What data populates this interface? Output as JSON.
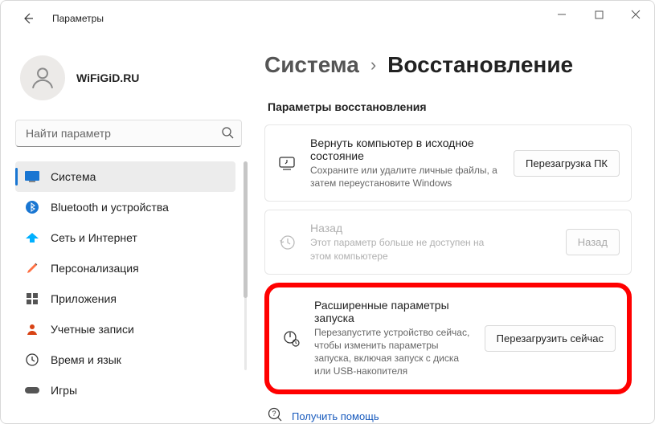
{
  "window": {
    "title": "Параметры"
  },
  "user": {
    "name": "WiFiGiD.RU"
  },
  "search": {
    "placeholder": "Найти параметр"
  },
  "nav": {
    "items": [
      {
        "label": "Система",
        "icon": "system",
        "active": true
      },
      {
        "label": "Bluetooth и устройства",
        "icon": "bluetooth"
      },
      {
        "label": "Сеть и Интернет",
        "icon": "network"
      },
      {
        "label": "Персонализация",
        "icon": "personalize"
      },
      {
        "label": "Приложения",
        "icon": "apps"
      },
      {
        "label": "Учетные записи",
        "icon": "accounts"
      },
      {
        "label": "Время и язык",
        "icon": "time"
      },
      {
        "label": "Игры",
        "icon": "games"
      }
    ]
  },
  "breadcrumb": {
    "parent": "Система",
    "current": "Восстановление"
  },
  "section_title": "Параметры восстановления",
  "cards": [
    {
      "title": "Вернуть компьютер в исходное состояние",
      "desc": "Сохраните или удалите личные файлы, а затем переустановите Windows",
      "button": "Перезагрузка ПК"
    },
    {
      "title": "Назад",
      "desc": "Этот параметр больше не доступен на этом компьютере",
      "button": "Назад"
    },
    {
      "title": "Расширенные параметры запуска",
      "desc": "Перезапустите устройство сейчас, чтобы изменить параметры запуска, включая запуск с диска или USB-накопителя",
      "button": "Перезагрузить сейчас"
    }
  ],
  "help": {
    "label": "Получить помощь"
  }
}
